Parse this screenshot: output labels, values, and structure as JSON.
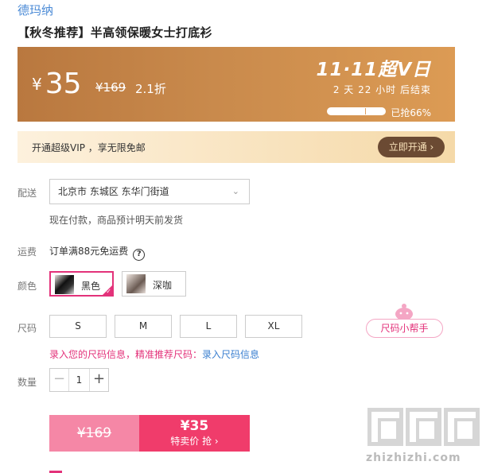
{
  "product": {
    "brand": "德玛纳",
    "title": "【秋冬推荐】半高领保暖女士打底衫"
  },
  "promo": {
    "currency": "¥",
    "price": "35",
    "original_price": "¥169",
    "discount": "2.1折",
    "event_name": "11·11超V日",
    "countdown": "2 天 22 小时 后结束",
    "sold_ratio": 0.66,
    "sold_text": "已抢66%"
  },
  "vip": {
    "text": "开通超级VIP ，享无限免邮",
    "button": "立即开通 ›"
  },
  "delivery": {
    "label": "配送",
    "address": "北京市 东城区 东华门街道",
    "note": "现在付款，商品预计明天前发货"
  },
  "freight": {
    "label": "运费",
    "text": "订单满88元免运费",
    "help": "?"
  },
  "color": {
    "label": "颜色",
    "options": [
      {
        "name": "黑色",
        "selected": true
      },
      {
        "name": "深咖",
        "selected": false
      }
    ]
  },
  "size": {
    "label": "尺码",
    "options": [
      "S",
      "M",
      "L",
      "XL"
    ],
    "helper": "尺码小帮手",
    "tip": "录入您的尺码信息，精准推荐尺码：",
    "tip_link": "录入尺码信息"
  },
  "quantity": {
    "label": "数量",
    "value": "1",
    "minus": "−",
    "plus": "+"
  },
  "buy": {
    "original_price": "¥169",
    "price": "¥35",
    "label": "特卖价 抢 ›"
  },
  "watermark": {
    "text": "zhizhizhi.com"
  },
  "colors": {
    "accent": "#e3327a",
    "buy_button": "#f03c6b",
    "promo_bg": "#c98a4c",
    "link": "#3a7fd0"
  }
}
